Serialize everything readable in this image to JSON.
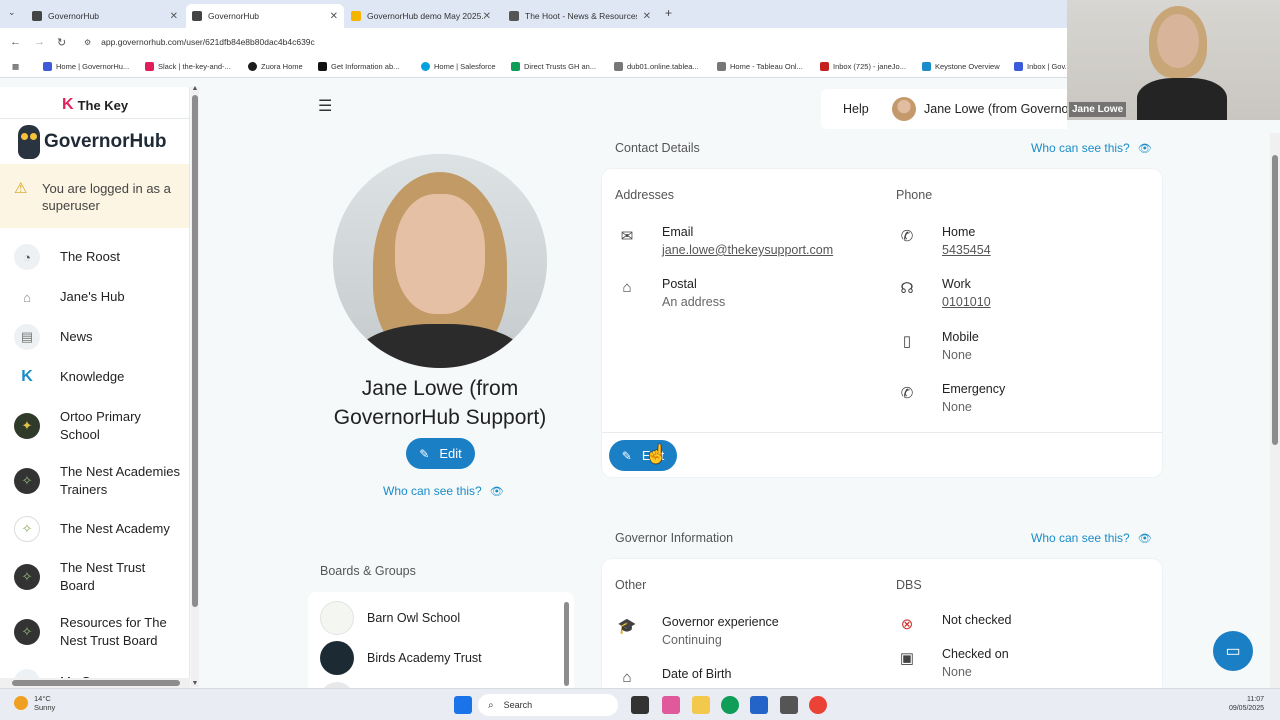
{
  "browser": {
    "tabs": [
      {
        "title": "GovernorHub",
        "active": false
      },
      {
        "title": "GovernorHub",
        "active": true
      },
      {
        "title": "GovernorHub demo May 2025...",
        "active": false
      },
      {
        "title": "The Hoot - News & Resources...",
        "active": false
      }
    ],
    "url": "app.governorhub.com/user/621dfb84e8b80dac4b4c639c",
    "bookmarks": [
      "Home | GovernorHu...",
      "Slack | the-key-and-...",
      "Zuora Home",
      "Get Information ab...",
      "Home | Salesforce",
      "Direct Trusts GH an...",
      "dub01.online.tablea...",
      "Home - Tableau Onl...",
      "Inbox (725) - janeJo...",
      "Keystone Overview",
      "Inbox | Gov..."
    ]
  },
  "webcam": {
    "name": "Jane Lowe"
  },
  "sidebar": {
    "thekey_label": "The Key",
    "brand": "GovernorHub",
    "superuser_notice": "You are logged in as a superuser",
    "items": [
      {
        "label": "The Roost",
        "icon": "roost-icon"
      },
      {
        "label": "Jane's Hub",
        "icon": "home-icon"
      },
      {
        "label": "News",
        "icon": "news-icon"
      },
      {
        "label": "Knowledge",
        "icon": "knowledge-icon"
      },
      {
        "label": "Ortoo Primary School",
        "icon": "school-logo-icon"
      },
      {
        "label": "The Nest Academies Trainers",
        "icon": "nest-logo-icon"
      },
      {
        "label": "The Nest Academy",
        "icon": "nest-academy-logo-icon"
      },
      {
        "label": "The Nest Trust Board",
        "icon": "nest-logo-icon"
      },
      {
        "label": "Resources for The Nest Trust Board",
        "icon": "nest-logo-icon"
      },
      {
        "label": "My G...",
        "icon": "group-icon"
      }
    ]
  },
  "header": {
    "help": "Help",
    "user": "Jane Lowe (from GovernorHub Support)"
  },
  "profile": {
    "name": "Jane Lowe (from GovernorHub Support)",
    "edit_label": "Edit",
    "who_can_see": "Who can see this?"
  },
  "contact": {
    "title": "Contact Details",
    "who_can_see": "Who can see this?",
    "addresses_head": "Addresses",
    "phone_head": "Phone",
    "email_label": "Email",
    "email_value": "jane.lowe@thekeysupport.com",
    "postal_label": "Postal",
    "postal_value": "An address",
    "home_label": "Home",
    "home_value": "5435454",
    "work_label": "Work",
    "work_value": "0101010",
    "mobile_label": "Mobile",
    "mobile_value": "None",
    "emergency_label": "Emergency",
    "emergency_value": "None",
    "edit_label": "Edit"
  },
  "governor": {
    "title": "Governor Information",
    "who_can_see": "Who can see this?",
    "other_head": "Other",
    "dbs_head": "DBS",
    "experience_label": "Governor experience",
    "experience_value": "Continuing",
    "dob_label": "Date of Birth",
    "dbs_status": "Not checked",
    "checked_on_label": "Checked on",
    "checked_on_value": "None"
  },
  "boards": {
    "title": "Boards & Groups",
    "items": [
      "Barn Owl School",
      "Birds Academy Trust"
    ]
  },
  "taskbar": {
    "temp": "14°C",
    "weather": "Sunny",
    "search": "Search",
    "time": "11:07",
    "date": "09/05/2025"
  },
  "colors": {
    "accent": "#1a7fc4",
    "link": "#1a8cc9",
    "warning_bg": "#fcf5e3"
  }
}
